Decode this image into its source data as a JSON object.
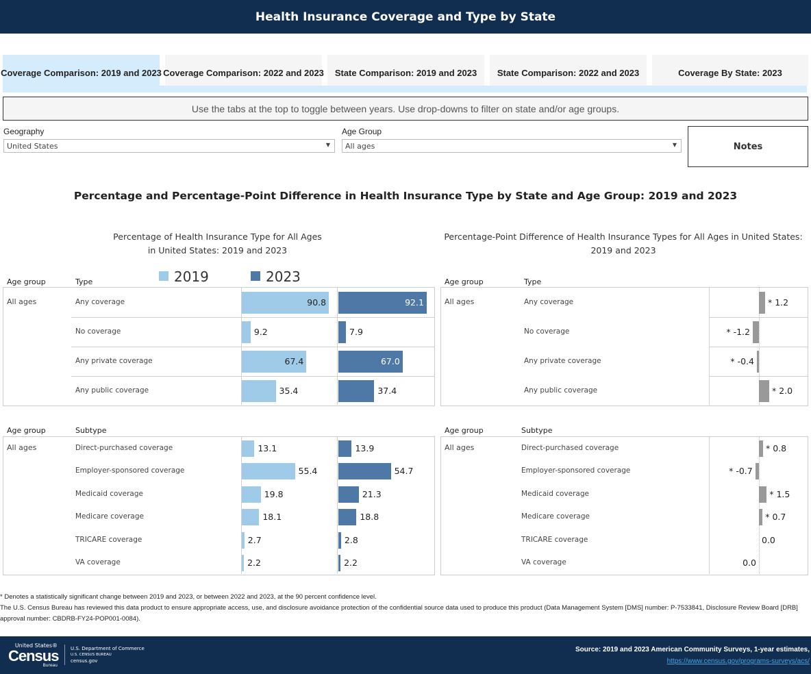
{
  "header": {
    "title": "Health Insurance Coverage and Type by State"
  },
  "tabs": [
    {
      "label": "Coverage Comparison: 2019 and 2023",
      "active": true
    },
    {
      "label": "Coverage Comparison: 2022 and 2023",
      "active": false
    },
    {
      "label": "State Comparison: 2019 and 2023",
      "active": false
    },
    {
      "label": "State Comparison: 2022 and 2023",
      "active": false
    },
    {
      "label": "Coverage By State: 2023",
      "active": false
    }
  ],
  "info_text": "Use the tabs at the top to toggle between years. Use drop-downs to filter on state and/or age groups.",
  "filters": {
    "geography_label": "Geography",
    "geography_value": "United States",
    "age_label": "Age Group",
    "age_value": "All ages",
    "notes_label": "Notes"
  },
  "main_title": "Percentage and Percentage-Point Difference in Health Insurance Type by State and Age Group: 2019 and 2023",
  "colors": {
    "y2019": "#a0cbe8",
    "y2023": "#4e79a7",
    "diff": "#999999",
    "header_bg": "#112e51"
  },
  "chart_data": [
    {
      "type": "bar",
      "title": "Percentage of Health Insurance Type for All Ages",
      "subtitle": "in United States: 2019 and 2023",
      "legend": [
        "2019",
        "2023"
      ],
      "legend_placement": "top",
      "col_age": "Age group",
      "col_type": "Type",
      "col_subtype": "Subtype",
      "age_group": "All ages",
      "types": [
        {
          "label": "Any coverage",
          "v2019": 90.8,
          "v2023": 92.1
        },
        {
          "label": "No coverage",
          "v2019": 9.2,
          "v2023": 7.9
        },
        {
          "label": "Any private coverage",
          "v2019": 67.4,
          "v2023": 67.0
        },
        {
          "label": "Any public coverage",
          "v2019": 35.4,
          "v2023": 37.4
        }
      ],
      "subtypes": [
        {
          "label": "Direct-purchased coverage",
          "v2019": 13.1,
          "v2023": 13.9
        },
        {
          "label": "Employer-sponsored coverage",
          "v2019": 55.4,
          "v2023": 54.7
        },
        {
          "label": "Medicaid coverage",
          "v2019": 19.8,
          "v2023": 21.3
        },
        {
          "label": "Medicare coverage",
          "v2019": 18.1,
          "v2023": 18.8
        },
        {
          "label": "TRICARE coverage",
          "v2019": 2.7,
          "v2023": 2.8
        },
        {
          "label": "VA coverage",
          "v2019": 2.2,
          "v2023": 2.2
        }
      ]
    },
    {
      "type": "bar",
      "title": "Percentage-Point Difference of Health Insurance Types for All Ages in United States:",
      "subtitle": "2019 and 2023",
      "col_age": "Age group",
      "col_type": "Type",
      "col_subtype": "Subtype",
      "age_group": "All ages",
      "types": [
        {
          "label": "Any coverage",
          "diff": 1.2,
          "significant": true
        },
        {
          "label": "No coverage",
          "diff": -1.2,
          "significant": true
        },
        {
          "label": "Any private coverage",
          "diff": -0.4,
          "significant": true
        },
        {
          "label": "Any public coverage",
          "diff": 2.0,
          "significant": true
        }
      ],
      "subtypes": [
        {
          "label": "Direct-purchased coverage",
          "diff": 0.8,
          "significant": true
        },
        {
          "label": "Employer-sponsored coverage",
          "diff": -0.7,
          "significant": true
        },
        {
          "label": "Medicaid coverage",
          "diff": 1.5,
          "significant": true
        },
        {
          "label": "Medicare coverage",
          "diff": 0.7,
          "significant": true
        },
        {
          "label": "TRICARE coverage",
          "diff": 0.0,
          "significant": false
        },
        {
          "label": "VA coverage",
          "diff": 0.0,
          "significant": false
        }
      ]
    }
  ],
  "footnotes": {
    "significance": "* Denotes a statistically significant change between 2019 and 2023, or between 2022 and 2023, at the 90 percent confidence level.",
    "disclosure": "The U.S. Census Bureau has reviewed this data product to ensure appropriate access, use, and disclosure avoidance protection of the confidential source data used to produce this product (Data Management System [DMS] number:  P-7533841, Disclosure Review Board [DRB] approval number:  CBDRB-FY24-POP001-0084)."
  },
  "footer": {
    "logo_text": "United States Census Bureau",
    "dept": "U.S. Department of Commerce",
    "bureau": "U.S. CENSUS BUREAU",
    "site": "census.gov",
    "source": "Source: 2019 and 2023 American Community Surveys, 1-year estimates,",
    "link": "https://www.census.gov/programs-surveys/acs/"
  }
}
